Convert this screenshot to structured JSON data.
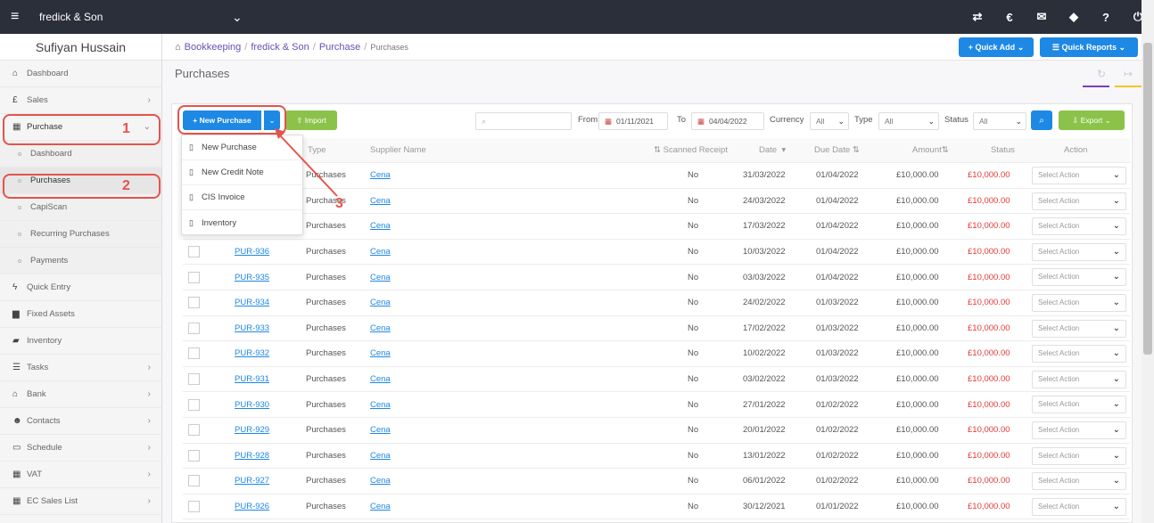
{
  "topbar": {
    "company": "fredick & Son",
    "icons": [
      "transfer-icon",
      "currency-icon",
      "megaphone-icon",
      "tag-icon",
      "help-icon",
      "power-icon"
    ]
  },
  "sidebar": {
    "user": "Sufiyan Hussain",
    "items": [
      {
        "label": "Dashboard",
        "icon": "home-icon"
      },
      {
        "label": "Sales",
        "icon": "pound-icon"
      },
      {
        "label": "Purchase",
        "icon": "purchase-icon"
      },
      {
        "label": "Dashboard"
      },
      {
        "label": "Purchases"
      },
      {
        "label": "CapiScan"
      },
      {
        "label": "Recurring Purchases"
      },
      {
        "label": "Payments"
      },
      {
        "label": "Quick Entry",
        "icon": "bolt-icon"
      },
      {
        "label": "Fixed Assets",
        "icon": "building-icon"
      },
      {
        "label": "Inventory",
        "icon": "truck-icon"
      },
      {
        "label": "Tasks",
        "icon": "tasks-icon"
      },
      {
        "label": "Bank",
        "icon": "bank-icon"
      },
      {
        "label": "Contacts",
        "icon": "contacts-icon"
      },
      {
        "label": "Schedule",
        "icon": "calendar-icon"
      },
      {
        "label": "VAT",
        "icon": "calculator-icon"
      },
      {
        "label": "EC Sales List",
        "icon": "calculator-icon"
      }
    ]
  },
  "breadcrumb": {
    "b1": "Bookkeeping",
    "b2": "fredick & Son",
    "b3": "Purchase",
    "b4": "Purchases"
  },
  "header": {
    "quick_add": "+ Quick Add",
    "quick_reports": "Quick Reports"
  },
  "page_title": "Purchases",
  "toolbar": {
    "new_purchase": "New Purchase",
    "import": "Import",
    "from_label": "From",
    "from_date": "01/11/2021",
    "to_label": "To",
    "to_date": "04/04/2022",
    "currency_label": "Currency",
    "currency_value": "All",
    "type_label": "Type",
    "type_value": "All",
    "status_label": "Status",
    "status_value": "All",
    "export": "Export"
  },
  "dropdown": [
    "New Purchase",
    "New Credit Note",
    "CIS Invoice",
    "Inventory"
  ],
  "table": {
    "headers": {
      "type": "Type",
      "supplier": "Supplier Name",
      "scanned": "Scanned Receipt",
      "date": "Date",
      "due": "Due Date",
      "amount": "Amount",
      "status": "Status",
      "action": "Action"
    },
    "rows": [
      {
        "ref": "",
        "type": "Purchases",
        "supplier": "Cena",
        "scanned": "No",
        "date": "31/03/2022",
        "due": "01/04/2022",
        "amount": "£10,000.00",
        "status": "£10,000.00",
        "action": "Select Action"
      },
      {
        "ref": "",
        "type": "Purchases",
        "supplier": "Cena",
        "scanned": "No",
        "date": "24/03/2022",
        "due": "01/04/2022",
        "amount": "£10,000.00",
        "status": "£10,000.00",
        "action": "Select Action"
      },
      {
        "ref": "",
        "type": "Purchases",
        "supplier": "Cena",
        "scanned": "No",
        "date": "17/03/2022",
        "due": "01/04/2022",
        "amount": "£10,000.00",
        "status": "£10,000.00",
        "action": "Select Action"
      },
      {
        "ref": "PUR-936",
        "type": "Purchases",
        "supplier": "Cena",
        "scanned": "No",
        "date": "10/03/2022",
        "due": "01/04/2022",
        "amount": "£10,000.00",
        "status": "£10,000.00",
        "action": "Select Action"
      },
      {
        "ref": "PUR-935",
        "type": "Purchases",
        "supplier": "Cena",
        "scanned": "No",
        "date": "03/03/2022",
        "due": "01/04/2022",
        "amount": "£10,000.00",
        "status": "£10,000.00",
        "action": "Select Action"
      },
      {
        "ref": "PUR-934",
        "type": "Purchases",
        "supplier": "Cena",
        "scanned": "No",
        "date": "24/02/2022",
        "due": "01/03/2022",
        "amount": "£10,000.00",
        "status": "£10,000.00",
        "action": "Select Action"
      },
      {
        "ref": "PUR-933",
        "type": "Purchases",
        "supplier": "Cena",
        "scanned": "No",
        "date": "17/02/2022",
        "due": "01/03/2022",
        "amount": "£10,000.00",
        "status": "£10,000.00",
        "action": "Select Action"
      },
      {
        "ref": "PUR-932",
        "type": "Purchases",
        "supplier": "Cena",
        "scanned": "No",
        "date": "10/02/2022",
        "due": "01/03/2022",
        "amount": "£10,000.00",
        "status": "£10,000.00",
        "action": "Select Action"
      },
      {
        "ref": "PUR-931",
        "type": "Purchases",
        "supplier": "Cena",
        "scanned": "No",
        "date": "03/02/2022",
        "due": "01/03/2022",
        "amount": "£10,000.00",
        "status": "£10,000.00",
        "action": "Select Action"
      },
      {
        "ref": "PUR-930",
        "type": "Purchases",
        "supplier": "Cena",
        "scanned": "No",
        "date": "27/01/2022",
        "due": "01/02/2022",
        "amount": "£10,000.00",
        "status": "£10,000.00",
        "action": "Select Action"
      },
      {
        "ref": "PUR-929",
        "type": "Purchases",
        "supplier": "Cena",
        "scanned": "No",
        "date": "20/01/2022",
        "due": "01/02/2022",
        "amount": "£10,000.00",
        "status": "£10,000.00",
        "action": "Select Action"
      },
      {
        "ref": "PUR-928",
        "type": "Purchases",
        "supplier": "Cena",
        "scanned": "No",
        "date": "13/01/2022",
        "due": "01/02/2022",
        "amount": "£10,000.00",
        "status": "£10,000.00",
        "action": "Select Action"
      },
      {
        "ref": "PUR-927",
        "type": "Purchases",
        "supplier": "Cena",
        "scanned": "No",
        "date": "06/01/2022",
        "due": "01/02/2022",
        "amount": "£10,000.00",
        "status": "£10,000.00",
        "action": "Select Action"
      },
      {
        "ref": "PUR-926",
        "type": "Purchases",
        "supplier": "Cena",
        "scanned": "No",
        "date": "30/12/2021",
        "due": "01/01/2022",
        "amount": "£10,000.00",
        "status": "£10,000.00",
        "action": "Select Action"
      }
    ]
  },
  "annotations": [
    "1",
    "2",
    "3"
  ],
  "colors": {
    "primary": "#1e88e5",
    "success": "#8bc34a",
    "danger": "#e53935",
    "annotation": "#e5534b",
    "topbar": "#2b2f3a"
  }
}
